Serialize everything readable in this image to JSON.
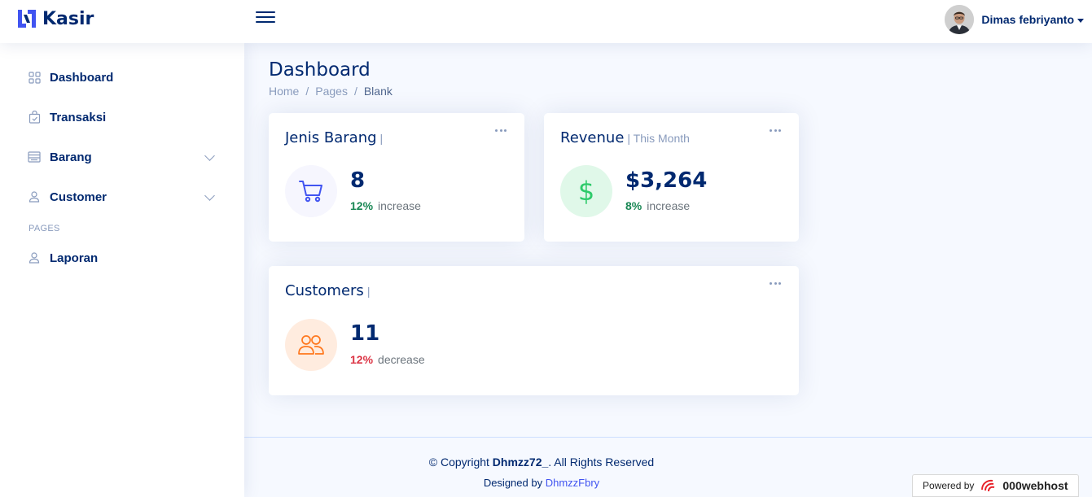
{
  "app": {
    "name": "Kasir"
  },
  "header": {
    "user_name": "Dimas febriyanto"
  },
  "sidebar": {
    "items": [
      {
        "label": "Dashboard",
        "icon": "grid-icon"
      },
      {
        "label": "Transaksi",
        "icon": "bag-check-icon"
      },
      {
        "label": "Barang",
        "icon": "layout-text-window-icon",
        "has_children": true
      },
      {
        "label": "Customer",
        "icon": "person-icon",
        "has_children": true
      }
    ],
    "heading": "PAGES",
    "pages": [
      {
        "label": "Laporan",
        "icon": "person-icon"
      }
    ]
  },
  "page": {
    "title": "Dashboard",
    "breadcrumb": [
      "Home",
      "Pages",
      "Blank"
    ]
  },
  "cards": {
    "jenis_barang": {
      "title": "Jenis Barang",
      "sub": "|",
      "value": "8",
      "pct": "12%",
      "trend": "increase",
      "icon": "cart-icon"
    },
    "revenue": {
      "title": "Revenue",
      "sub": "| This Month",
      "value": "$3,264",
      "pct": "8%",
      "trend": "increase",
      "icon": "currency-dollar-icon"
    },
    "customers": {
      "title": "Customers",
      "sub": "|",
      "value": "11",
      "pct": "12%",
      "trend": "decrease",
      "icon": "people-icon"
    }
  },
  "colors": {
    "primary": "#012970",
    "accent": "#4154f1",
    "muted": "#899bbd",
    "success": "#198754",
    "danger": "#dc3545",
    "revenue_bg": "#e0f8e9",
    "revenue_fg": "#2eca6a",
    "sales_bg": "#f6f6fe",
    "customers_bg": "#ffecdf",
    "customers_fg": "#ff771d"
  },
  "footer": {
    "copyright_prefix": "© Copyright",
    "copyright_name": "Dhmzz72_",
    "copyright_suffix": ". All Rights Reserved",
    "designed_by": "Designed by",
    "designer": "DhmzzFbry"
  },
  "badge": {
    "label": "Powered by",
    "brand": "000webhost"
  }
}
